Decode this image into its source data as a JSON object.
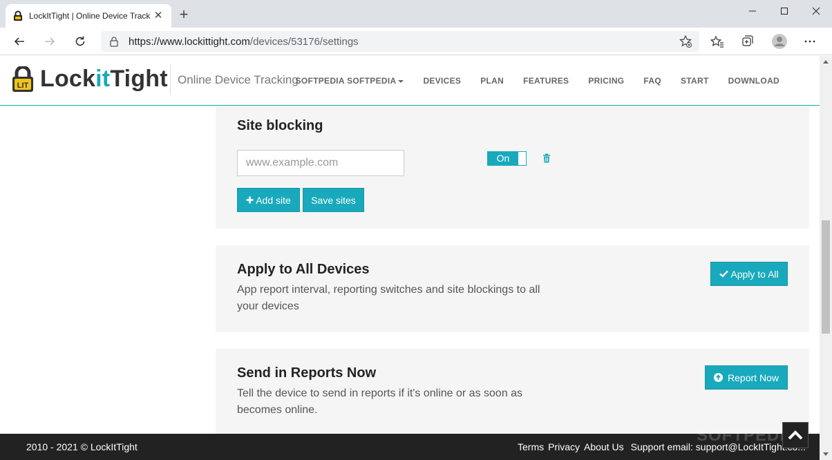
{
  "browser": {
    "tab_title": "LockItTight | Online Device Track",
    "url_host": "https://www.lockittight.com",
    "url_path": "/devices/53176/settings"
  },
  "site": {
    "logo_part1": "Lock",
    "logo_part2": "it",
    "logo_part3": "Tight",
    "logo_badge": "LIT",
    "tagline": "Online Device Tracking",
    "nav": [
      "SOFTPEDIA SOFTPEDIA",
      "DEVICES",
      "PLAN",
      "FEATURES",
      "PRICING",
      "FAQ",
      "START",
      "DOWNLOAD"
    ]
  },
  "site_blocking": {
    "title": "Site blocking",
    "placeholder": "www.example.com",
    "toggle_label": "On",
    "add_label": "Add site",
    "save_label": "Save sites"
  },
  "apply_all": {
    "title": "Apply to All Devices",
    "desc": "App report interval, reporting switches and site blockings to all your devices",
    "button": "Apply to All"
  },
  "report_now": {
    "title": "Send in Reports Now",
    "desc": "Tell the device to send in reports if it's online or as soon as becomes online.",
    "button": "Report Now"
  },
  "footer": {
    "copyright": "2010 - 2021 © LockItTight",
    "terms": "Terms",
    "privacy": "Privacy",
    "about": "About Us",
    "support": "Support email: support@LockItTight.co..."
  },
  "watermark": "SOFTPEDIA",
  "colors": {
    "accent": "#19a9bc",
    "footer": "#222222",
    "panel": "#f5f5f5"
  }
}
